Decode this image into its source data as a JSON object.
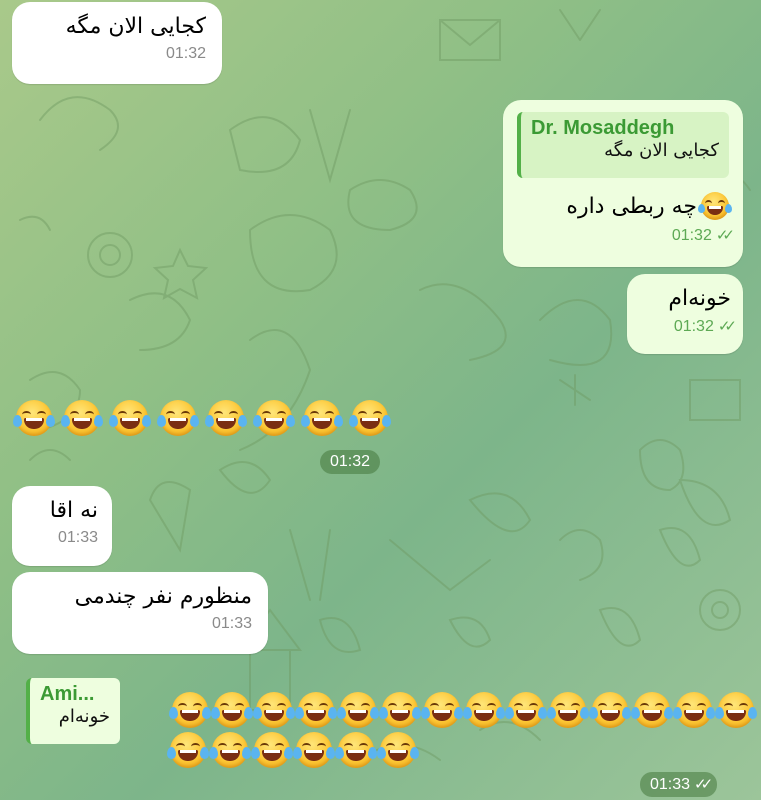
{
  "chat": {
    "messages": [
      {
        "id": "m1",
        "direction": "in",
        "text": "کجایی الان مگه",
        "time": "01:32"
      },
      {
        "id": "m2",
        "direction": "out",
        "reply_to": {
          "name": "Dr. Mosaddegh",
          "text": "کجایی الان مگه"
        },
        "text": "چه ربطی داره",
        "time": "01:32"
      },
      {
        "id": "m3",
        "direction": "out",
        "text": "خونه‌ام",
        "time": "01:32"
      },
      {
        "id": "m4",
        "direction": "in",
        "emoji_count": 8,
        "emoji": "face-with-tears-of-joy",
        "time": "01:32"
      },
      {
        "id": "m5",
        "direction": "in",
        "text": "نه اقا",
        "time": "01:33"
      },
      {
        "id": "m6",
        "direction": "in",
        "text": "منظورم نفر چندمی",
        "time": "01:33"
      },
      {
        "id": "m7",
        "direction": "out",
        "reply_to": {
          "name": "Ami...",
          "text": "خونه‌ام"
        },
        "emoji_count": 20,
        "emoji": "face-with-tears-of-joy",
        "time": "01:33"
      }
    ]
  },
  "colors": {
    "accent": "#53b048",
    "outgoing_bubble": "#eefedf",
    "incoming_bubble": "#ffffff"
  }
}
